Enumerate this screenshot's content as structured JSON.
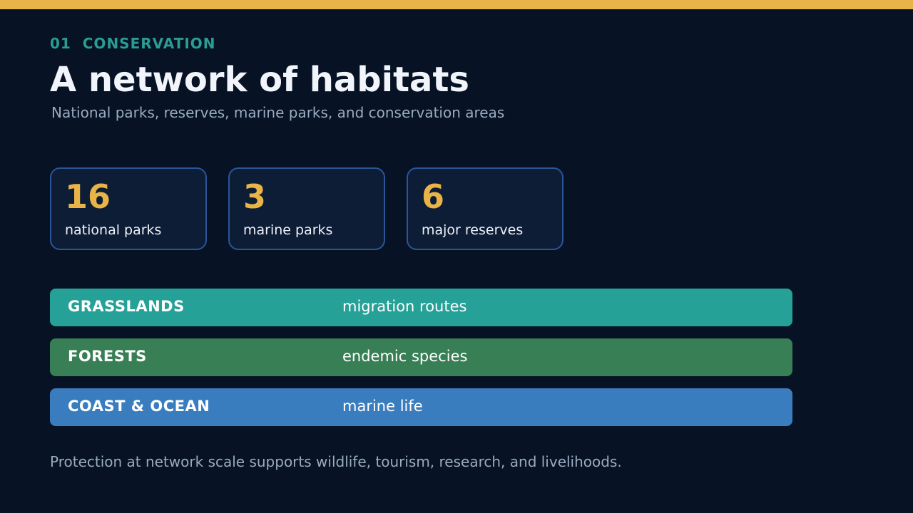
{
  "colors": {
    "background": "#071224",
    "accent_bar": "#e8b447",
    "eyebrow": "#2a9d93",
    "stat_value": "#e8b447",
    "band_grasslands": "#26a197",
    "band_forests": "#387f55",
    "band_coast": "#3a7dbf"
  },
  "header": {
    "eyebrow": "01  CONSERVATION",
    "title": "A network of habitats",
    "subtitle": "National parks, reserves, marine parks, and conservation areas"
  },
  "stats": [
    {
      "value": "16",
      "label": "national parks"
    },
    {
      "value": "3",
      "label": "marine parks"
    },
    {
      "value": "6",
      "label": "major reserves"
    }
  ],
  "habitats": [
    {
      "name": "GRASSLANDS",
      "description": "migration routes"
    },
    {
      "name": "FORESTS",
      "description": "endemic species"
    },
    {
      "name": "COAST & OCEAN",
      "description": "marine life"
    }
  ],
  "footer": {
    "text": "Protection at network scale supports wildlife, tourism, research, and livelihoods."
  }
}
